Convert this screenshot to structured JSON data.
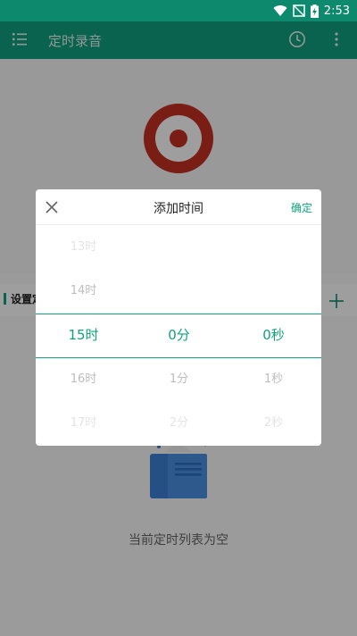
{
  "status_bar": {
    "time": "2:53",
    "icons": [
      "wifi-icon",
      "no-signal-icon",
      "battery-charging-icon"
    ]
  },
  "toolbar": {
    "title": "定时录音",
    "icons": [
      "menu-list-icon",
      "clock-icon",
      "more-vert-icon"
    ]
  },
  "colors": {
    "accent": "#11a07e",
    "status_bar": "#0d8a6e",
    "record_red": "#c62f22"
  },
  "section": {
    "title": "设置定"
  },
  "empty_state": {
    "text": "当前定时列表为空"
  },
  "dialog": {
    "title": "添加时间",
    "confirm_label": "确定",
    "close_icon": "close-icon",
    "picker": {
      "hours": [
        "13时",
        "14时",
        "15时",
        "16时",
        "17时"
      ],
      "minutes": [
        "",
        "",
        "0分",
        "1分",
        "2分"
      ],
      "seconds": [
        "",
        "",
        "0秒",
        "1秒",
        "2秒"
      ],
      "selected": {
        "hour": "15时",
        "minute": "0分",
        "second": "0秒"
      }
    }
  }
}
